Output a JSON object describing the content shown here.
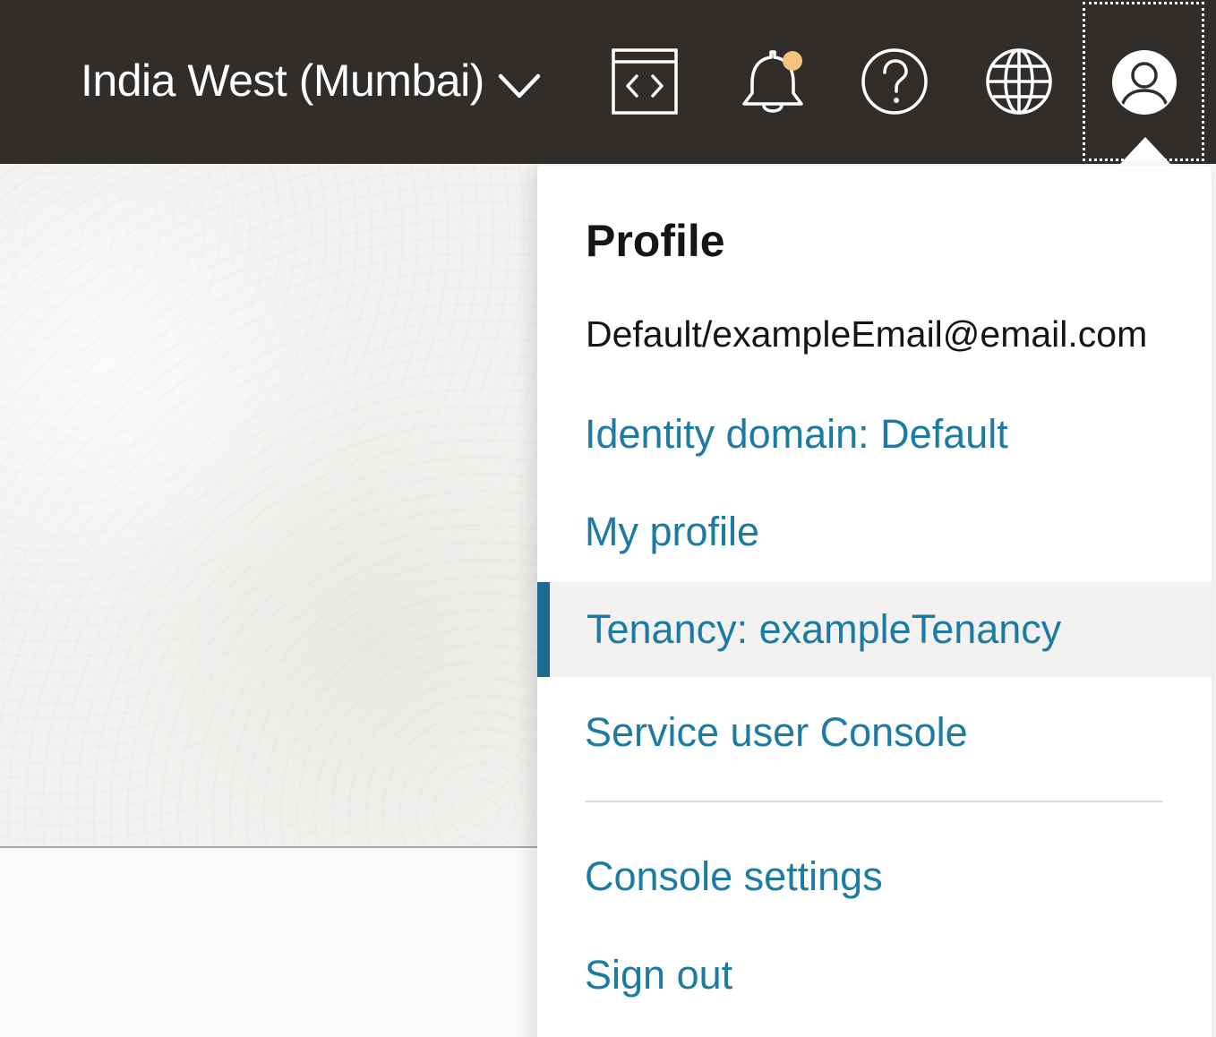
{
  "header": {
    "region_label": "India West (Mumbai)",
    "icons": {
      "code": "code-editor-icon",
      "bell": "bell-icon",
      "help": "help-icon",
      "globe": "globe-icon",
      "avatar": "user-avatar-icon"
    },
    "notification_dot_color": "#f2c47e",
    "background_color": "#312d2a"
  },
  "profile_menu": {
    "title": "Profile",
    "user": "Default/exampleEmail@email.com",
    "items": [
      {
        "label": "Identity domain: Default"
      },
      {
        "label": "My profile"
      },
      {
        "label": "Tenancy: exampleTenancy",
        "active": true
      },
      {
        "label": "Service user Console"
      },
      {
        "label": "Console settings"
      },
      {
        "label": "Sign out"
      }
    ],
    "link_color": "#1c7ba2",
    "active_indicator_color": "#1d6b8f"
  }
}
